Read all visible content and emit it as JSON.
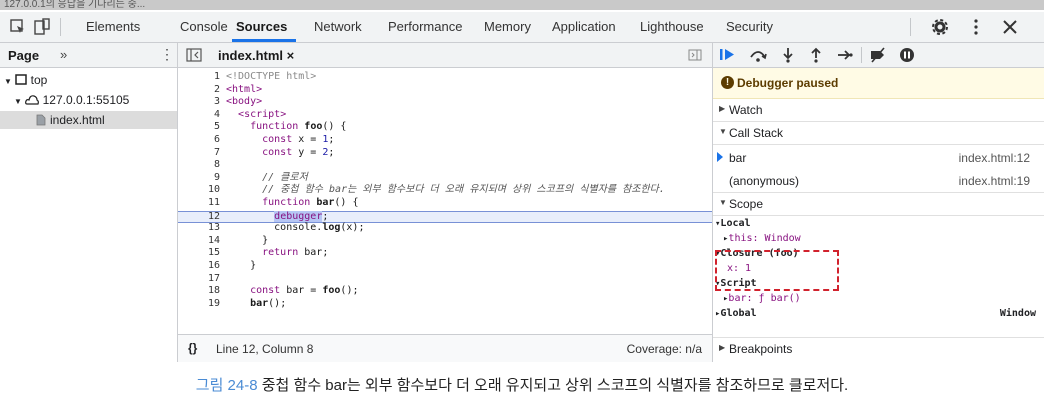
{
  "window_title": "127.0.0.1의 응답을 기다리는 중...",
  "tabs": [
    "Elements",
    "Console",
    "Sources",
    "Network",
    "Performance",
    "Memory",
    "Application",
    "Lighthouse",
    "Security"
  ],
  "active_tab": "Sources",
  "left_pane": {
    "title": "Page",
    "more": "»",
    "kebab": "⋮",
    "tree": [
      "top",
      "127.0.0.1:55105",
      "index.html"
    ]
  },
  "editor": {
    "tab_label": "index.html ×",
    "lines": [
      {
        "n": "1",
        "html": "<span class=\"doctype\">&lt;!DOCTYPE html&gt;</span>"
      },
      {
        "n": "2",
        "html": "<span class=\"tag\">&lt;html&gt;</span>"
      },
      {
        "n": "3",
        "html": "<span class=\"tag\">&lt;body&gt;</span>"
      },
      {
        "n": "4",
        "html": "  <span class=\"tag\">&lt;script&gt;</span>"
      },
      {
        "n": "5",
        "html": "    <span class=\"kw\">function</span> <b>foo</b>() {"
      },
      {
        "n": "6",
        "html": "      <span class=\"kw\">const</span> x = <span class=\"str\">1</span>;"
      },
      {
        "n": "7",
        "html": "      <span class=\"kw\">const</span> y = <span class=\"str\">2</span>;"
      },
      {
        "n": "8",
        "html": ""
      },
      {
        "n": "9",
        "html": "      <span class=\"cm\">// 클로저</span>"
      },
      {
        "n": "10",
        "html": "      <span class=\"cm\">// 중첩 함수 bar는 외부 함수보다 더 오래 유지되며 상위 스코프의 식별자를 참조한다.</span>"
      },
      {
        "n": "11",
        "html": "      <span class=\"kw\">function</span> <b>bar</b>() {"
      },
      {
        "n": "12",
        "html": "        <span class=\"dbg\"><span class=\"kw\">debugger</span></span>;"
      },
      {
        "n": "13",
        "html": "        console.<b>log</b>(x);"
      },
      {
        "n": "14",
        "html": "      }"
      },
      {
        "n": "15",
        "html": "      <span class=\"kw\">return</span> bar;"
      },
      {
        "n": "16",
        "html": "    }"
      },
      {
        "n": "17",
        "html": ""
      },
      {
        "n": "18",
        "html": "    <span class=\"kw\">const</span> bar = <b>foo</b>();"
      },
      {
        "n": "19",
        "html": "    <b>bar</b>();"
      }
    ],
    "braces": "{}",
    "status": "Line 12, Column 8",
    "coverage": "Coverage: n/a"
  },
  "debugger": {
    "paused_label": "Debugger paused",
    "watch": "Watch",
    "call_stack": "Call Stack",
    "stack": [
      {
        "name": "bar",
        "loc": "index.html:12"
      },
      {
        "name": "(anonymous)",
        "loc": "index.html:19"
      }
    ],
    "scope": "Scope",
    "scope_lines": [
      {
        "arrow": "▾",
        "text": "Local",
        "indent": 2,
        "bold": true
      },
      {
        "arrow": "▸",
        "text": "this: Window",
        "indent": 10,
        "kw": true
      },
      {
        "arrow": "▾",
        "text": "Closure (foo)",
        "indent": 2,
        "bold": true
      },
      {
        "arrow": "",
        "text": "x: 1",
        "indent": 14,
        "kw": true
      },
      {
        "arrow": "▾",
        "text": "Script",
        "indent": 2,
        "bold": true
      },
      {
        "arrow": "▸",
        "text": "bar: ƒ bar()",
        "indent": 10,
        "kw": true
      },
      {
        "arrow": "▸",
        "text": "Global",
        "indent": 2,
        "bold": true,
        "right": "Window"
      }
    ],
    "breakpoints": "Breakpoints"
  },
  "caption": {
    "fig": "그림 24-8",
    "text": " 중첩 함수 bar는 외부 함수보다 더 오래 유지되고 상위 스코프의 식별자를 참조하므로 클로저다."
  },
  "colors": {
    "accent": "#1a73e8",
    "highlight_box": "#d1222d",
    "paused_bg": "#fffbe5",
    "caption_fig": "#4a8bd4"
  }
}
